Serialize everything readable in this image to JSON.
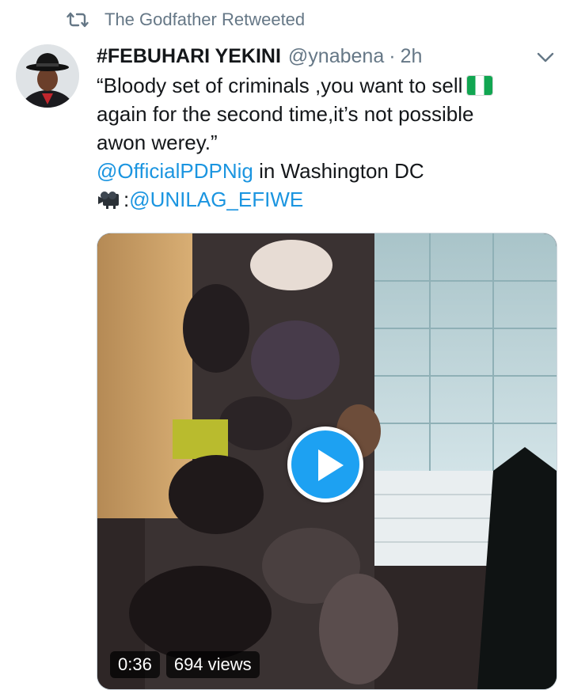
{
  "retweet": {
    "icon": "retweet-icon",
    "text": "The Godfather Retweeted"
  },
  "tweet": {
    "display_name": "#FEBUHARI YEKINI",
    "handle": "@ynabena",
    "separator": "·",
    "time": "2h",
    "menu_icon": "chevron-down-icon",
    "text_line1": "“Bloody set of criminals ,you want to sell",
    "flag_icon": "nigeria-flag-emoji",
    "text_line2": "again for the second time,it’s not possible",
    "text_line3": "awon werey.”",
    "mention1": "@OfficialPDPNig",
    "mention1_suffix": " in Washington DC",
    "camera_icon": "video-camera-emoji",
    "camera_prefix": ":",
    "mention2": "@UNILAG_EFIWE"
  },
  "media": {
    "play_icon": "play-icon",
    "duration": "0:36",
    "views": "694 views"
  },
  "colors": {
    "link": "#1b95e0",
    "secondary_text": "#657786",
    "play_button": "#1da1f2",
    "flag_green": "#11a651"
  }
}
